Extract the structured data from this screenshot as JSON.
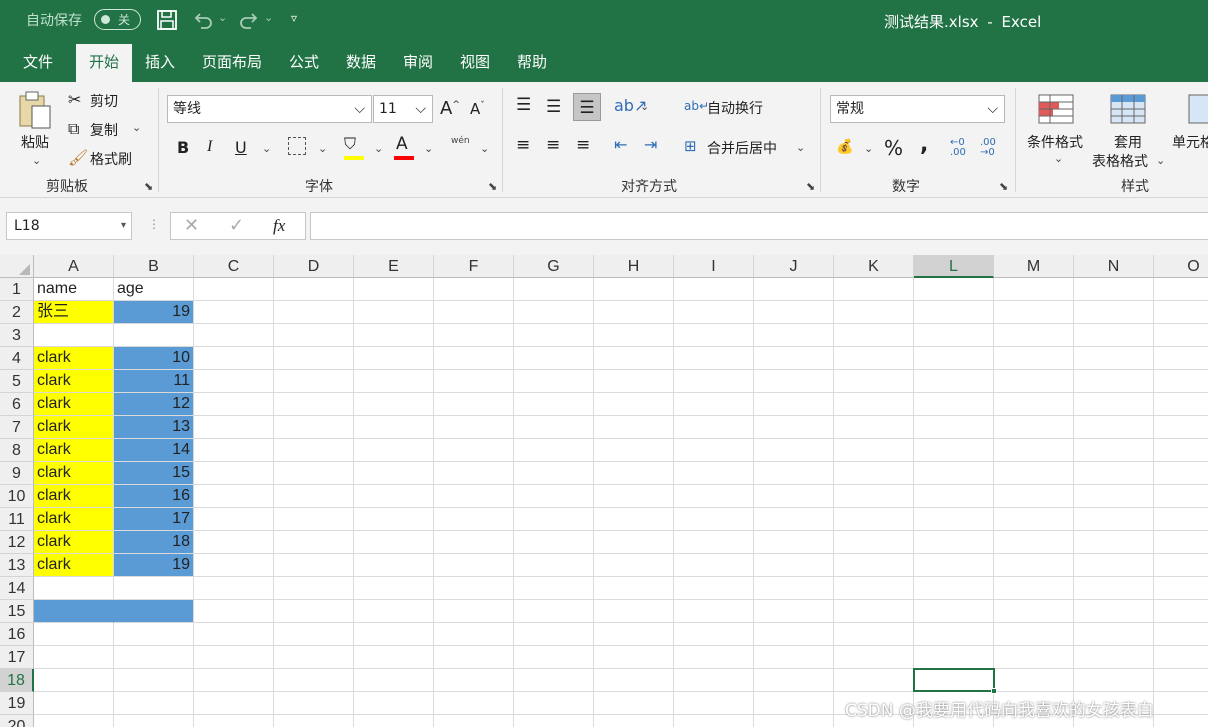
{
  "titlebar": {
    "autosave_label": "自动保存",
    "autosave_state": "关",
    "filename": "测试结果.xlsx",
    "separator": "-",
    "app": "Excel"
  },
  "tabs": [
    "文件",
    "开始",
    "插入",
    "页面布局",
    "公式",
    "数据",
    "审阅",
    "视图",
    "帮助"
  ],
  "active_tab": "开始",
  "ribbon": {
    "clipboard": {
      "paste": "粘贴",
      "cut": "剪切",
      "copy": "复制",
      "format_painter": "格式刷",
      "group": "剪贴板"
    },
    "font": {
      "name": "等线",
      "size": "11",
      "group": "字体",
      "bold": "B",
      "italic": "I",
      "underline": "U",
      "phonetic": "wén"
    },
    "alignment": {
      "wrap": "自动换行",
      "merge": "合并后居中",
      "group": "对齐方式"
    },
    "number": {
      "format": "常规",
      "group": "数字",
      "percent": "%",
      "comma": ","
    },
    "styles": {
      "conditional": "条件格式",
      "table_line1": "套用",
      "table_line2": "表格格式",
      "cell_styles": "单元格",
      "group": "样式"
    }
  },
  "formula_bar": {
    "name_box": "L18",
    "fx": "fx",
    "value": ""
  },
  "columns": [
    "A",
    "B",
    "C",
    "D",
    "E",
    "F",
    "G",
    "H",
    "I",
    "J",
    "K",
    "L",
    "M",
    "N",
    "O"
  ],
  "active_column": "L",
  "rows": [
    "1",
    "2",
    "3",
    "4",
    "5",
    "6",
    "7",
    "8",
    "9",
    "10",
    "11",
    "12",
    "13",
    "14",
    "15",
    "16",
    "17",
    "18",
    "19",
    "20"
  ],
  "active_row": "18",
  "cells": {
    "A1": "name",
    "B1": "age",
    "A2": "张三",
    "B2": "19",
    "A4": "clark",
    "B4": "10",
    "A5": "clark",
    "B5": "11",
    "A6": "clark",
    "B6": "12",
    "A7": "clark",
    "B7": "13",
    "A8": "clark",
    "B8": "14",
    "A9": "clark",
    "B9": "15",
    "A10": "clark",
    "B10": "16",
    "A11": "clark",
    "B11": "17",
    "A12": "clark",
    "B12": "18",
    "A13": "clark",
    "B13": "19"
  },
  "fill_colors": {
    "yellow": "#ffff00",
    "blue": "#5b9bd5",
    "excel_green": "#217346"
  },
  "watermark": "CSDN @我要用代码向我喜欢的女孩表白"
}
